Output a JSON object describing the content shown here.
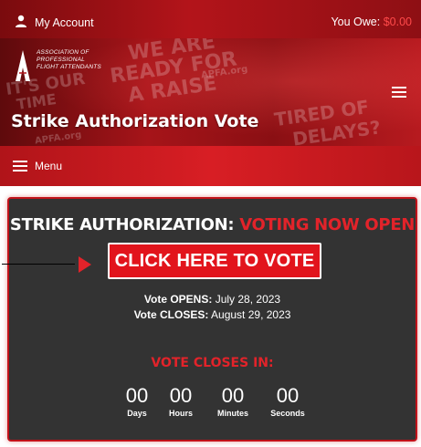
{
  "header": {
    "account_label": "My Account",
    "owe_label": "You Owe:",
    "owe_amount": "$0.00"
  },
  "logo": {
    "line1": "ASSOCIATION OF",
    "line2": "PROFESSIONAL",
    "line3": "FLIGHT ATTENDANTS",
    "monogram": "AFA"
  },
  "hero": {
    "title": "Strike Authorization Vote",
    "signs": [
      "WE ARE",
      "READY FOR",
      "A RAISE",
      "IT'S OUR",
      "TIME",
      "TIRED OF",
      "DELAYS?",
      "APFA.org",
      "APFA.org"
    ]
  },
  "menu": {
    "label": "Menu"
  },
  "vote": {
    "heading_white": "STRIKE AUTHORIZATION:",
    "heading_red": "VOTING NOW OPEN",
    "button_label": "CLICK HERE TO VOTE",
    "opens_label": "Vote OPENS:",
    "opens_date": "July 28, 2023",
    "closes_label": "Vote CLOSES:",
    "closes_date": "August 29, 2023",
    "countdown_title": "VOTE CLOSES IN:",
    "countdown": [
      {
        "value": "00",
        "label": "Days"
      },
      {
        "value": "00",
        "label": "Hours"
      },
      {
        "value": "00",
        "label": "Minutes"
      },
      {
        "value": "00",
        "label": "Seconds"
      }
    ]
  },
  "colors": {
    "accent": "#e2232a",
    "card_bg": "#333333"
  }
}
